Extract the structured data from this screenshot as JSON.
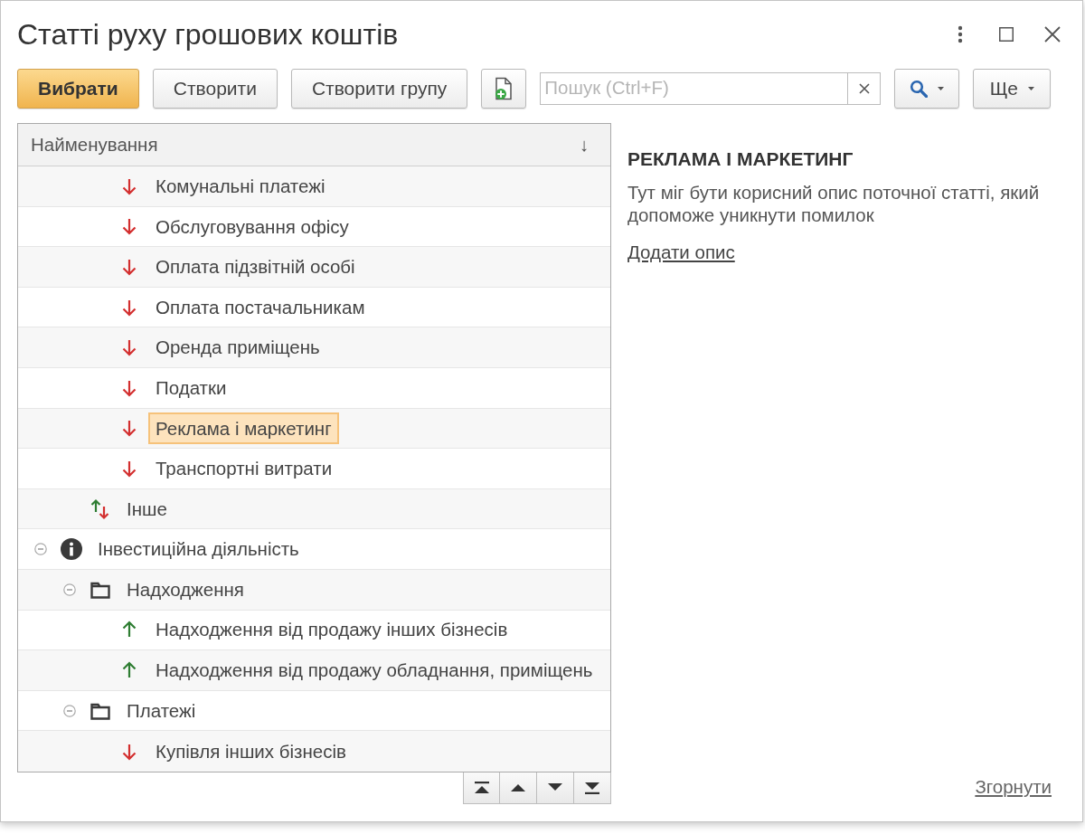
{
  "window": {
    "title": "Статті руху грошових коштів"
  },
  "toolbar": {
    "buttons": [
      {
        "kind": "primary",
        "label": "Вибрати"
      },
      {
        "kind": "plain",
        "label": "Створити"
      },
      {
        "kind": "plain",
        "label": "Створити групу"
      },
      {
        "kind": "icon"
      }
    ],
    "search": {
      "placeholder": "Пошук (Ctrl+F)"
    },
    "more_button": {
      "label": "Ще"
    }
  },
  "tree": {
    "column": "Найменування",
    "sort_mark": "↓",
    "items": [
      {
        "children": [
          {
            "children": [
              {
                "label": "Комунальні платежі",
                "kind": "expense",
                "selected": false
              },
              {
                "label": "Обслуговування офісу",
                "kind": "expense",
                "selected": false
              },
              {
                "label": "Оплата підзвітній особі",
                "kind": "expense",
                "selected": false
              },
              {
                "label": "Оплата постачальникам",
                "kind": "expense",
                "selected": false
              },
              {
                "label": "Оренда приміщень",
                "kind": "expense",
                "selected": false
              },
              {
                "label": "Податки",
                "kind": "expense",
                "selected": false
              },
              {
                "label": "Реклама і маркетинг",
                "kind": "expense",
                "selected": true
              },
              {
                "label": "Транспортні витрати",
                "kind": "expense",
                "selected": false
              }
            ]
          },
          {
            "label": "Інше",
            "kind": "mixed",
            "selected": false
          }
        ]
      },
      {
        "label": "Інвестиційна діяльність",
        "kind": "section",
        "expanded": true,
        "selected": false,
        "children": [
          {
            "label": "Надходження",
            "kind": "group",
            "expanded": true,
            "selected": false,
            "children": [
              {
                "label": "Надходження від продажу інших бізнесів",
                "kind": "income",
                "selected": false
              },
              {
                "label": "Надходження від продажу обладнання, приміщень",
                "kind": "income",
                "selected": false
              }
            ]
          },
          {
            "label": "Платежі",
            "kind": "group",
            "expanded": true,
            "selected": false,
            "children": [
              {
                "label": "Купівля інших бізнесів",
                "kind": "expense",
                "selected": false
              }
            ]
          }
        ]
      }
    ]
  },
  "details": {
    "title": "РЕКЛАМА І МАРКЕТИНГ",
    "description": "Тут міг бути корисний опис поточної статті, який допоможе уникнути помилок",
    "link": "Додати опис"
  },
  "collapse_link": "Згорнути"
}
